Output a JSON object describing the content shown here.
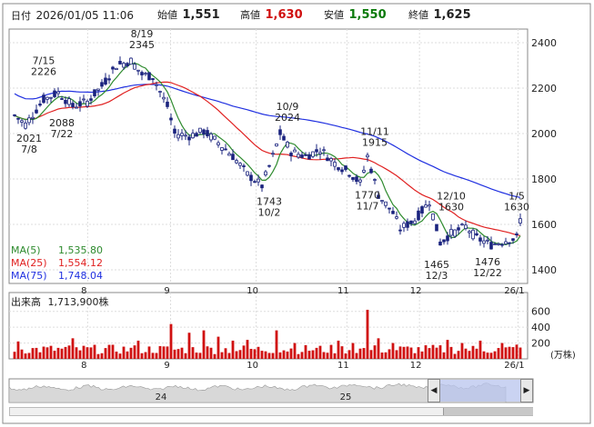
{
  "header": {
    "date_label": "日付",
    "datetime": "2026/01/05 11:06",
    "open_label": "始値",
    "open_value": "1,551",
    "high_label": "高値",
    "high_value": "1,630",
    "low_label": "安値",
    "low_value": "1,550",
    "close_label": "終値",
    "close_value": "1,625"
  },
  "colors": {
    "up": "#ffffff",
    "down": "#1a237e",
    "candle_border": "#1a237e",
    "ma5": "#2e8b2e",
    "ma25": "#e02020",
    "ma75": "#2030e0",
    "high_text": "#d01010",
    "low_text": "#0a7a0a",
    "volume": "#d01010",
    "navigator_fill": "#b8c4ee"
  },
  "ma_legend": [
    {
      "label": "MA(5)",
      "value": "1,535.80",
      "color": "#2e8b2e"
    },
    {
      "label": "MA(25)",
      "value": "1,554.12",
      "color": "#e02020"
    },
    {
      "label": "MA(75)",
      "value": "1,748.04",
      "color": "#2030e0"
    }
  ],
  "volume_panel": {
    "title": "出来高",
    "value": "1,713,900株",
    "unit": "(万株)",
    "y_ticks": [
      "600",
      "400",
      "200"
    ]
  },
  "navigator": {
    "labels": [
      "24",
      "25"
    ],
    "left_arrow": "◀",
    "right_arrow": "▶"
  },
  "chart_data": {
    "type": "candlestick",
    "y_ticks": [
      1400,
      1600,
      1800,
      2000,
      2200,
      2400
    ],
    "ylim": [
      1340,
      2460
    ],
    "x_ticks": [
      "8",
      "9",
      "10",
      "11",
      "12",
      "26/1"
    ],
    "x_tick_index": [
      3,
      26,
      49,
      72,
      92,
      113
    ],
    "n_days": 116,
    "annotations": [
      {
        "text": [
          "7/15",
          "2226"
        ],
        "i": 8,
        "price": 2226,
        "pos": "above"
      },
      {
        "text": [
          "8/19",
          "2345"
        ],
        "i": 34,
        "price": 2345,
        "pos": "above"
      },
      {
        "text": [
          "10/9",
          "2024"
        ],
        "i": 73,
        "price": 2024,
        "pos": "above"
      },
      {
        "text": [
          "11/11",
          "1915"
        ],
        "i": 96,
        "price": 1915,
        "pos": "above"
      },
      {
        "text": [
          "12/10",
          "1630"
        ],
        "i": 117,
        "price": 1630,
        "pos": "above"
      },
      {
        "text": [
          "1/5",
          "1630"
        ],
        "i": 134,
        "price": 1630,
        "pos": "above"
      },
      {
        "text": [
          "2021",
          "7/8"
        ],
        "i": 4,
        "price": 2021,
        "pos": "below"
      },
      {
        "text": [
          "2088",
          "7/22"
        ],
        "i": 13,
        "price": 2088,
        "pos": "below"
      },
      {
        "text": [
          "1743",
          "10/2"
        ],
        "i": 68,
        "price": 1743,
        "pos": "below"
      },
      {
        "text": [
          "1770",
          "11/7"
        ],
        "i": 94,
        "price": 1770,
        "pos": "below"
      },
      {
        "text": [
          "1465",
          "12/3"
        ],
        "i": 113,
        "price": 1465,
        "pos": "below"
      },
      {
        "text": [
          "1476",
          "12/22"
        ],
        "i": 126,
        "price": 1476,
        "pos": "below"
      }
    ]
  }
}
